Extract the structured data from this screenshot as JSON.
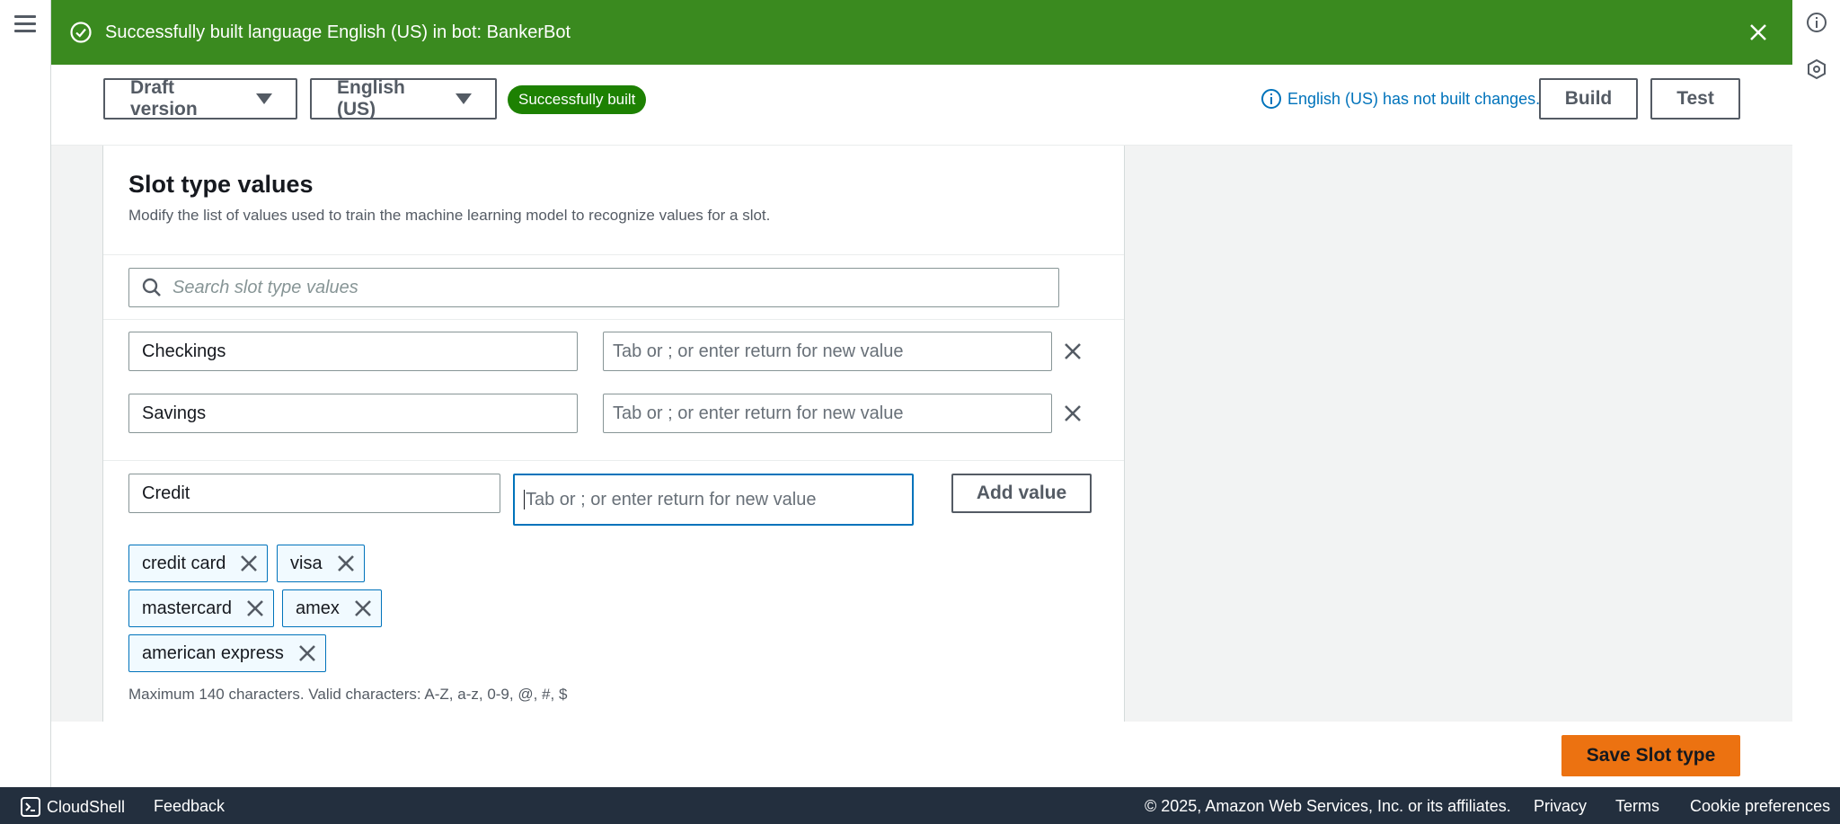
{
  "flash": {
    "message": "Successfully built language English (US) in bot: BankerBot",
    "icon": "check-circle-icon",
    "color": "#3a8a1f"
  },
  "toolbar": {
    "version_label": "Draft version",
    "language_label": "English (US)",
    "status_badge": "Successfully built",
    "not_built_note": "English (US) has not built changes.",
    "build_label": "Build",
    "test_label": "Test"
  },
  "slot_panel": {
    "title": "Slot type values",
    "description": "Modify the list of values used to train the machine learning model to recognize values for a slot.",
    "search_placeholder": "Search slot type values",
    "rows": [
      {
        "value": "Checkings",
        "synonym_placeholder": "Tab or ; or enter  return for new value"
      },
      {
        "value": "Savings",
        "synonym_placeholder": "Tab or ; or enter  return for new value"
      }
    ],
    "new_value": "Credit",
    "new_synonym_placeholder": "Tab or ; or enter  return for new value",
    "add_value_label": "Add value",
    "tokens": [
      "credit card",
      "visa",
      "mastercard",
      "amex",
      "american express"
    ],
    "constraint_note": "Maximum 140 characters. Valid characters: A-Z, a-z, 0-9, @, #, $"
  },
  "save_label": "Save Slot type",
  "footer": {
    "cloudshell": "CloudShell",
    "feedback": "Feedback",
    "copyright": "© 2025, Amazon Web Services, Inc. or its affiliates.",
    "privacy": "Privacy",
    "terms": "Terms",
    "cookie": "Cookie preferences"
  },
  "colors": {
    "accent_orange": "#ec7211",
    "link_blue": "#0073bb",
    "success_green": "#1d8102",
    "footer_bg": "#232f3e"
  }
}
